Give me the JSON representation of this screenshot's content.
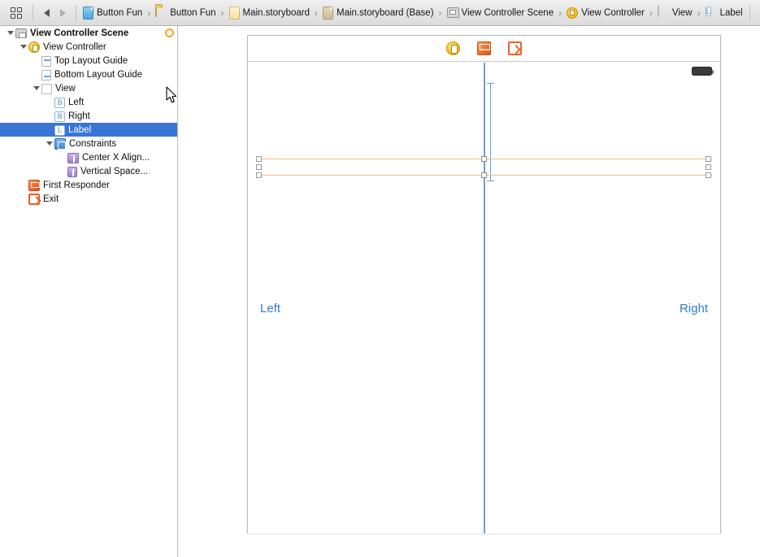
{
  "jumpbar": {
    "related_items_icon": "grid-icon",
    "back_icon": "back-arrow-icon",
    "forward_icon": "forward-arrow-icon",
    "crumbs": [
      {
        "label": "Button Fun",
        "icon": "project-icon"
      },
      {
        "label": "Button Fun",
        "icon": "folder-icon"
      },
      {
        "label": "Main.storyboard",
        "icon": "storyboard-icon"
      },
      {
        "label": "Main.storyboard (Base)",
        "icon": "storyboard-base-icon"
      },
      {
        "label": "View Controller Scene",
        "icon": "scene-icon"
      },
      {
        "label": "View Controller",
        "icon": "view-controller-icon"
      },
      {
        "label": "View",
        "icon": "view-icon"
      },
      {
        "label": "Label",
        "icon": "label-icon"
      }
    ],
    "separator": "›",
    "issue_prev_icon": "previous-issue-icon",
    "warning_icon": "warning-icon",
    "issue_next_icon": "next-issue-icon"
  },
  "outline": {
    "rows": [
      {
        "label": "View Controller Scene",
        "icon": "scene-icon",
        "indent": 0,
        "disclosure": "open",
        "bold": true,
        "selected": false,
        "trailing": "scene-dot"
      },
      {
        "label": "View Controller",
        "icon": "view-controller-icon",
        "indent": 1,
        "disclosure": "open",
        "bold": false,
        "selected": false,
        "trailing": ""
      },
      {
        "label": "Top Layout Guide",
        "icon": "top-layout-guide-icon",
        "indent": 2,
        "disclosure": "none",
        "bold": false,
        "selected": false,
        "trailing": ""
      },
      {
        "label": "Bottom Layout Guide",
        "icon": "bottom-layout-guide-icon",
        "indent": 2,
        "disclosure": "none",
        "bold": false,
        "selected": false,
        "trailing": ""
      },
      {
        "label": "View",
        "icon": "view-icon",
        "indent": 2,
        "disclosure": "open",
        "bold": false,
        "selected": false,
        "trailing": ""
      },
      {
        "label": "Left",
        "icon": "button-icon",
        "indent": 3,
        "disclosure": "none",
        "bold": false,
        "selected": false,
        "trailing": ""
      },
      {
        "label": "Right",
        "icon": "button-icon",
        "indent": 3,
        "disclosure": "none",
        "bold": false,
        "selected": false,
        "trailing": ""
      },
      {
        "label": "Label",
        "icon": "label-icon",
        "indent": 3,
        "disclosure": "none",
        "bold": false,
        "selected": true,
        "trailing": ""
      },
      {
        "label": "Constraints",
        "icon": "constraints-icon",
        "indent": 3,
        "disclosure": "open",
        "bold": false,
        "selected": false,
        "trailing": ""
      },
      {
        "label": "Center X Align...",
        "icon": "center-x-align-icon",
        "indent": 4,
        "disclosure": "none",
        "bold": false,
        "selected": false,
        "trailing": ""
      },
      {
        "label": "Vertical Space...",
        "icon": "vertical-space-icon",
        "indent": 4,
        "disclosure": "none",
        "bold": false,
        "selected": false,
        "trailing": ""
      },
      {
        "label": "First Responder",
        "icon": "first-responder-icon",
        "indent": 1,
        "disclosure": "none",
        "bold": false,
        "selected": false,
        "trailing": ""
      },
      {
        "label": "Exit",
        "icon": "exit-icon",
        "indent": 1,
        "disclosure": "none",
        "bold": false,
        "selected": false,
        "trailing": ""
      }
    ],
    "button_icon_glyph": "B",
    "label_icon_glyph": "L"
  },
  "canvas": {
    "scene_dock": [
      {
        "name": "view-controller",
        "icon": "view-controller-dock-icon"
      },
      {
        "name": "first-responder",
        "icon": "first-responder-dock-icon"
      },
      {
        "name": "exit",
        "icon": "exit-dock-icon"
      }
    ],
    "status_bar": {
      "battery_icon": "battery-icon"
    },
    "buttons": [
      {
        "name": "left-button",
        "label": "Left"
      },
      {
        "name": "right-button",
        "label": "Right"
      }
    ],
    "selected_object": "Label",
    "constraints_visible": [
      "Center X Alignment",
      "Vertical Space"
    ],
    "scene_entry_arrow": "initial-view-controller-arrow",
    "accent_blue": "#2f7cd6",
    "constraint_blue": "#6e9fc4",
    "constraint_orange": "#f0c27b",
    "selection_blue": "#3875d7"
  },
  "cursor": {
    "icon": "mouse-pointer-icon"
  }
}
